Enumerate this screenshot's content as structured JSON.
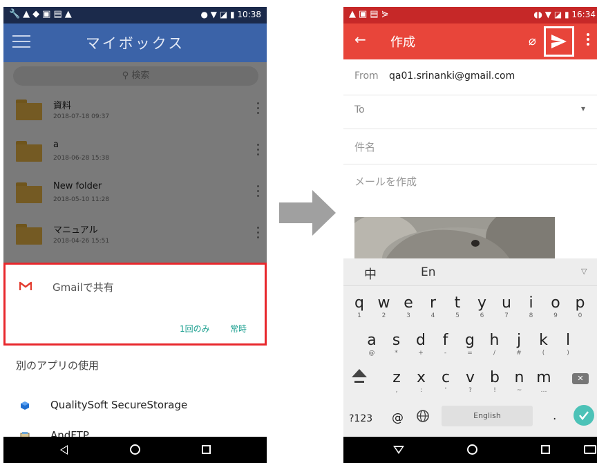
{
  "left_screen": {
    "status_time": "10:38",
    "app_title": "マイボックス",
    "search_placeholder": "検索",
    "files": [
      {
        "name": "資料",
        "date": "2018-07-18 09:37"
      },
      {
        "name": "a",
        "date": "2018-06-28 15:38"
      },
      {
        "name": "New folder",
        "date": "2018-05-10 11:28"
      },
      {
        "name": "マニュアル",
        "date": "2018-04-26 15:51"
      }
    ],
    "share_sheet": {
      "gmail_label": "Gmailで共有",
      "once_label": "1回のみ",
      "always_label": "常時",
      "other_apps_label": "別のアプリの使用",
      "apps": [
        {
          "label": "QualitySoft SecureStorage",
          "icon": "securestorage-icon"
        },
        {
          "label": "AndFTP",
          "icon": "andftp-icon"
        }
      ]
    }
  },
  "right_screen": {
    "status_time": "16:34",
    "title": "作成",
    "from_label": "From",
    "from_value": "qa01.srinanki@gmail.com",
    "to_label": "To",
    "subject_placeholder": "件名",
    "body_placeholder": "メールを作成",
    "keyboard": {
      "lang_zh": "中",
      "lang_en": "En",
      "row1": [
        {
          "k": "q",
          "n": "1"
        },
        {
          "k": "w",
          "n": "2"
        },
        {
          "k": "e",
          "n": "3"
        },
        {
          "k": "r",
          "n": "4"
        },
        {
          "k": "t",
          "n": "5"
        },
        {
          "k": "y",
          "n": "6"
        },
        {
          "k": "u",
          "n": "7"
        },
        {
          "k": "i",
          "n": "8"
        },
        {
          "k": "o",
          "n": "9"
        },
        {
          "k": "p",
          "n": "0"
        }
      ],
      "row2": [
        {
          "k": "a",
          "n": "@"
        },
        {
          "k": "s",
          "n": "*"
        },
        {
          "k": "d",
          "n": "+"
        },
        {
          "k": "f",
          "n": "-"
        },
        {
          "k": "g",
          "n": "="
        },
        {
          "k": "h",
          "n": "/"
        },
        {
          "k": "j",
          "n": "#"
        },
        {
          "k": "k",
          "n": "("
        },
        {
          "k": "l",
          "n": ")"
        }
      ],
      "row3": [
        {
          "k": "z",
          "n": ","
        },
        {
          "k": "x",
          "n": ":"
        },
        {
          "k": "c",
          "n": "'"
        },
        {
          "k": "v",
          "n": "?"
        },
        {
          "k": "b",
          "n": "!"
        },
        {
          "k": "n",
          "n": "~"
        },
        {
          "k": "m",
          "n": "…"
        }
      ],
      "symbols_key": "?123",
      "at_key": "@",
      "space_label": "English",
      "period_key": "."
    }
  },
  "colors": {
    "left_appbar": "#3b63a8",
    "right_appbar": "#e8453a",
    "highlight_border": "#e8272c",
    "action_text": "#1a9f8f",
    "folder": "#f2bd4a",
    "enter_key": "#4cc2b7"
  }
}
